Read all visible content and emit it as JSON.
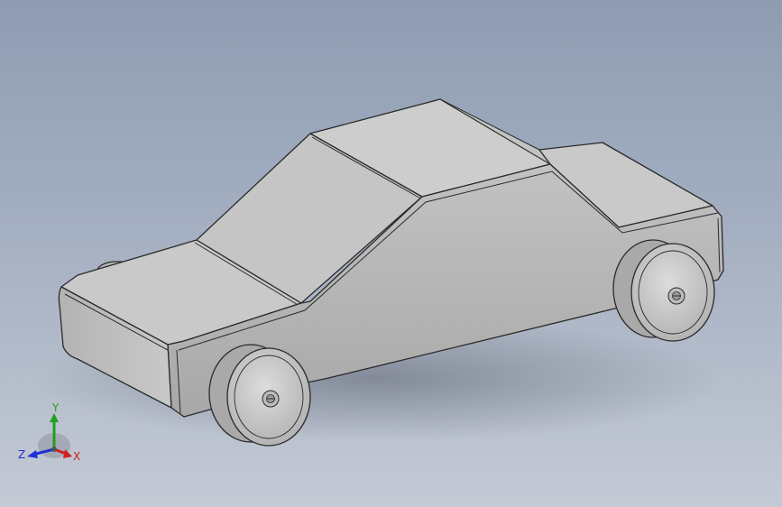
{
  "viewport": {
    "background_top": "#8e9cb2",
    "background_bottom": "#c4cad5"
  },
  "model": {
    "part_color": "#c8c8c8",
    "edge_color": "#2a2a2a",
    "wheel_count": 4,
    "visible_wheels": 2
  },
  "triad": {
    "x_label": "X",
    "y_label": "Y",
    "z_label": "Z",
    "x_color": "#d02020",
    "y_color": "#20a020",
    "z_color": "#2030d0"
  }
}
